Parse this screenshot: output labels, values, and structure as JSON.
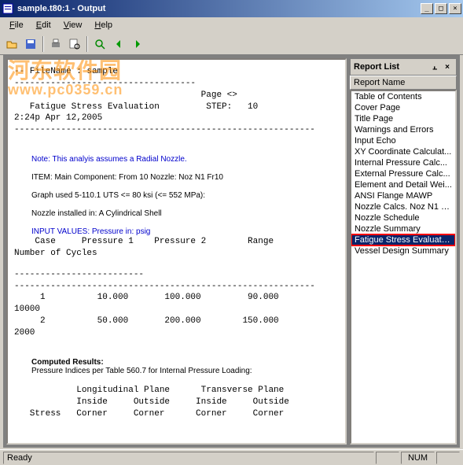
{
  "window": {
    "title": "sample.t80:1 - Output"
  },
  "menu": {
    "file": "File",
    "edit": "Edit",
    "view": "View",
    "help": "Help"
  },
  "watermark": {
    "line1": "河东软件园",
    "line2": "www.pc0359.cn"
  },
  "doc": {
    "header1": "-- FileName : sample",
    "dash1": "-----------------------------------",
    "page": "                                    Page <>",
    "title": "   Fatigue Stress Evaluation         STEP:   10",
    "time": "2:24p Apr 12,2005",
    "dash2": "----------------------------------------------------------",
    "note": "Note:  This analyis assumes a Radial Nozzle.",
    "item": "ITEM: Main Component: From 10          Nozzle: Noz N1 Fr10",
    "graph": "Graph used 5-110.1 UTS <= 80 ksi (<= 552 MPa):",
    "nozzle": "Nozzle installed in: A Cylindrical Shell",
    "inputv": "INPUT VALUES: Pressure in: psig",
    "th1": "    Case     Pressure 1    Pressure 2        Range",
    "th2": "Number of Cycles",
    "dashA": "-------------------------",
    "dashB": "----------------------------------------------------------",
    "row1": "     1          10.000       100.000         90.000",
    "row1b": "10000",
    "row2": "     2          50.000       200.000        150.000",
    "row2b": "2000",
    "comp": "Computed Results:",
    "pidx": "Pressure Indices per Table 560.7 for Internal Pressure Loading:",
    "pl1": "            Longitudinal Plane      Transverse Plane",
    "pl2": "            Inside     Outside     Inside     Outside",
    "pl3": "   Stress   Corner     Corner      Corner     Corner"
  },
  "rpanel": {
    "title": "Report List",
    "header": "Report Name",
    "items": [
      "Table of Contents",
      "Cover Page",
      "Title Page",
      "Warnings and Errors",
      "Input Echo",
      "XY Coordinate Calculat...",
      "Internal Pressure Calc...",
      "External Pressure Calc...",
      "Element and Detail Wei...",
      "ANSI Flange MAWP",
      "Nozzle Calcs. Noz N1 F...",
      "Nozzle Schedule",
      "Nozzle Summary",
      "Fatigue Stress Evaluation",
      "Vessel Design Summary"
    ],
    "selected": 13
  },
  "status": {
    "ready": "Ready",
    "num": "NUM"
  }
}
